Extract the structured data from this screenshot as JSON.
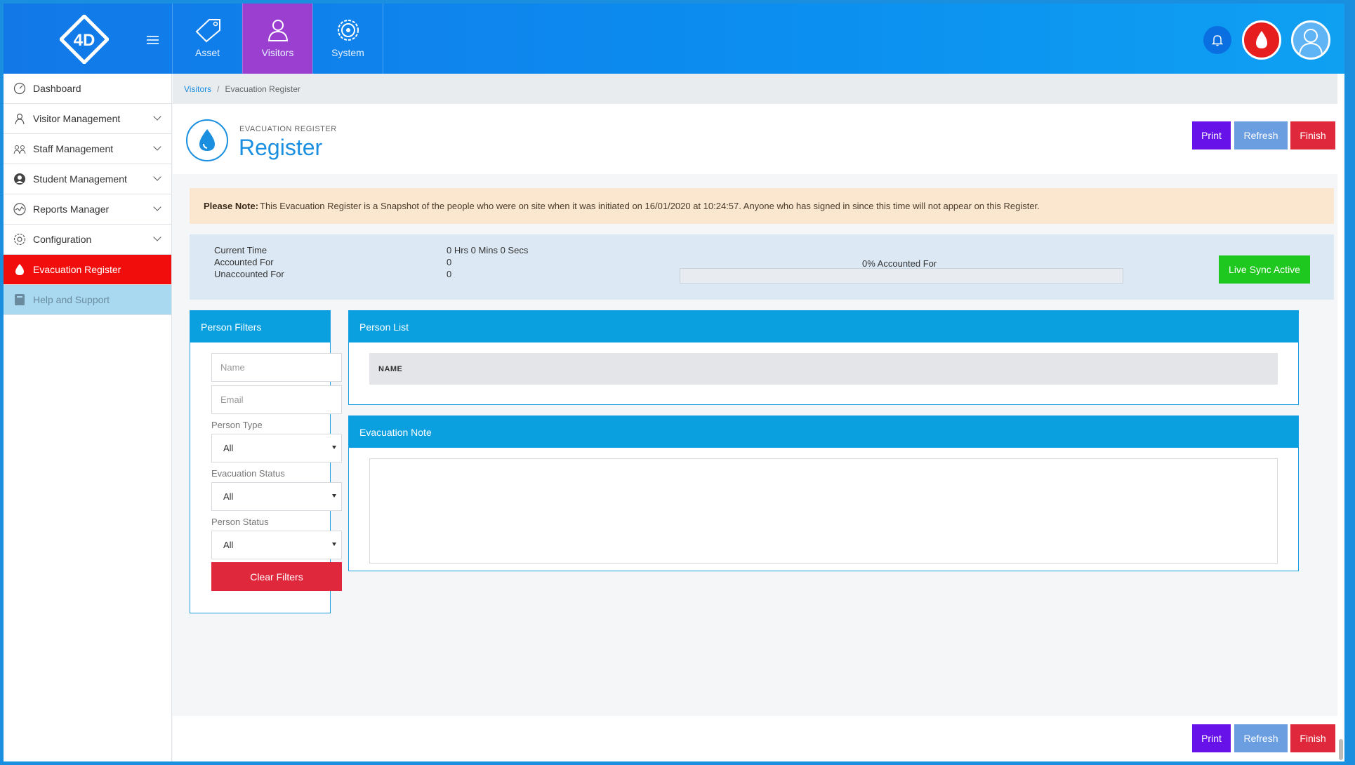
{
  "app": {
    "logo_text": "4D"
  },
  "topnav": {
    "modules": [
      {
        "label": "Asset",
        "icon": "tag-icon"
      },
      {
        "label": "Visitors",
        "icon": "person-icon"
      },
      {
        "label": "System",
        "icon": "gear-icon"
      }
    ],
    "active_module": "Visitors"
  },
  "sidebar": {
    "items": [
      {
        "label": "Dashboard",
        "icon": "dashboard-icon",
        "expandable": false
      },
      {
        "label": "Visitor Management",
        "icon": "visitor-icon",
        "expandable": true
      },
      {
        "label": "Staff Management",
        "icon": "staff-icon",
        "expandable": true
      },
      {
        "label": "Student Management",
        "icon": "student-icon",
        "expandable": true
      },
      {
        "label": "Reports Manager",
        "icon": "reports-icon",
        "expandable": true
      },
      {
        "label": "Configuration",
        "icon": "config-gear-icon",
        "expandable": true
      },
      {
        "label": "Evacuation Register",
        "icon": "flame-icon",
        "expandable": false
      },
      {
        "label": "Help and Support",
        "icon": "book-icon",
        "expandable": false
      }
    ]
  },
  "breadcrumb": {
    "parent": "Visitors",
    "separator": "/",
    "current": "Evacuation Register"
  },
  "header": {
    "subtitle": "EVACUATION REGISTER",
    "title": "Register"
  },
  "actions": {
    "print": "Print",
    "refresh": "Refresh",
    "finish": "Finish"
  },
  "notice": {
    "label": "Please Note:",
    "text": "This Evacuation Register is a Snapshot of the people who were on site when it was initiated on 16/01/2020 at 10:24:57. Anyone who has signed in since this time will not appear on this Register."
  },
  "stats": {
    "current_time_label": "Current Time",
    "current_time_value": "0 Hrs 0 Mins 0 Secs",
    "accounted_label": "Accounted For",
    "accounted_value": "0",
    "unaccounted_label": "Unaccounted For",
    "unaccounted_value": "0",
    "progress_label": "0% Accounted For",
    "progress_fraction": 0,
    "live_sync": "Live Sync Active"
  },
  "filters": {
    "title": "Person Filters",
    "name_placeholder": "Name",
    "email_placeholder": "Email",
    "person_type_label": "Person Type",
    "person_type_value": "All",
    "evac_status_label": "Evacuation Status",
    "evac_status_value": "All",
    "person_status_label": "Person Status",
    "person_status_value": "All",
    "clear": "Clear Filters"
  },
  "person_list": {
    "title": "Person List",
    "columns": [
      "NAME"
    ]
  },
  "evac_note": {
    "title": "Evacuation Note",
    "value": ""
  },
  "colors": {
    "primary": "#1a8fe0",
    "active_module": "#9b3fd1",
    "evac_red": "#f20d0d",
    "print": "#6712e8",
    "refresh": "#6a9ee0",
    "finish": "#e0283c",
    "live_sync": "#1ec81e"
  }
}
